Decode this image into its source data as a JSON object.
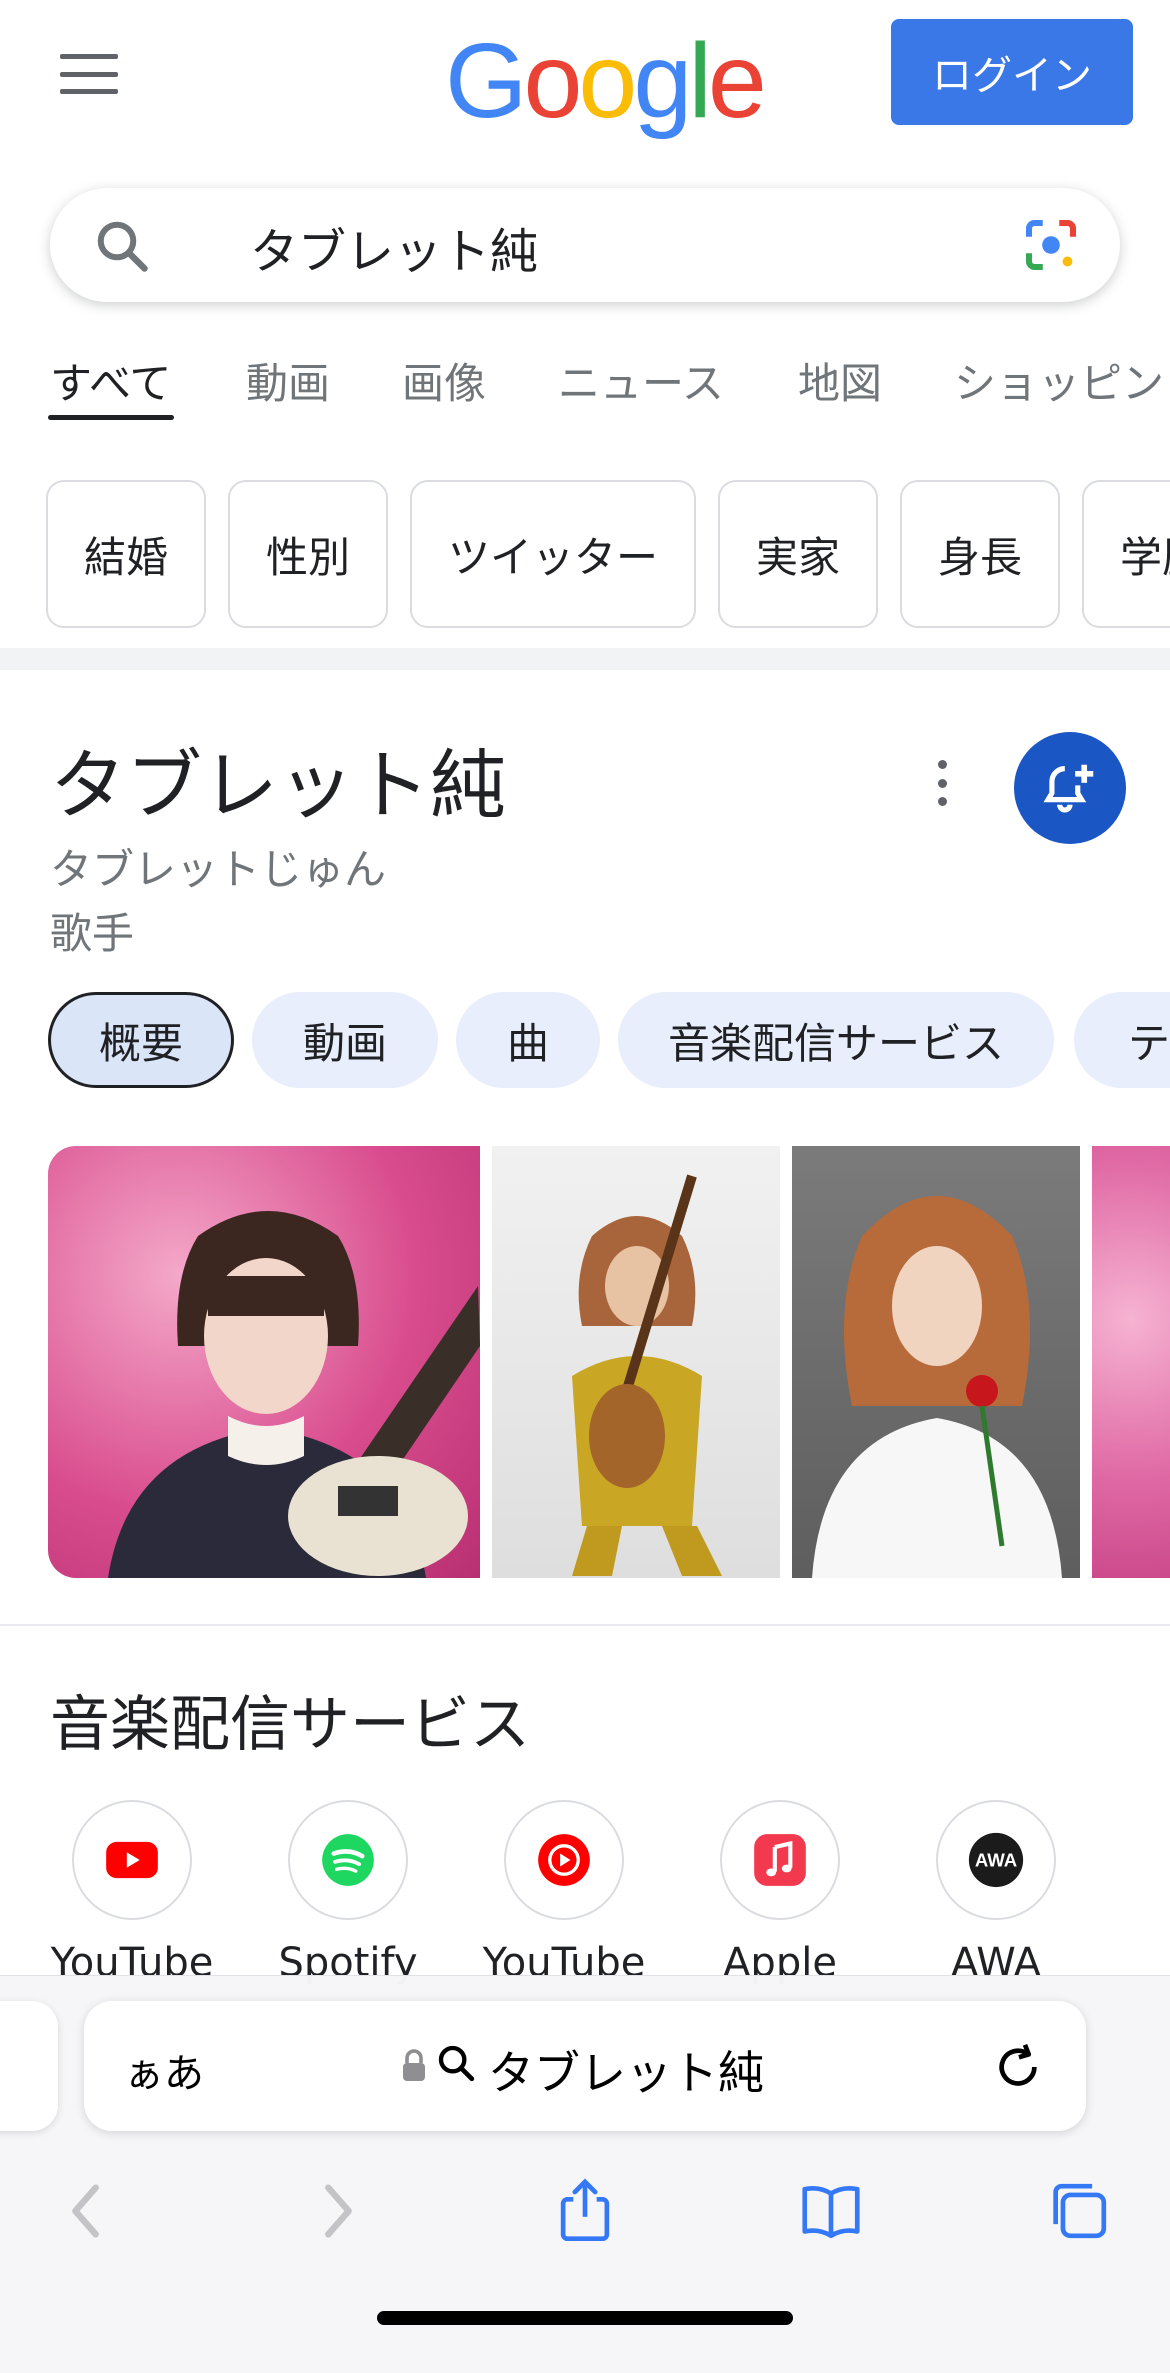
{
  "header": {
    "logo": [
      "G",
      "o",
      "o",
      "g",
      "l",
      "e"
    ],
    "login_label": "ログイン"
  },
  "search": {
    "query": "タブレット純"
  },
  "tabs": [
    "すべて",
    "動画",
    "画像",
    "ニュース",
    "地図",
    "ショッピン"
  ],
  "chips": [
    "結婚",
    "性別",
    "ツイッター",
    "実家",
    "身長",
    "学歴"
  ],
  "knowledge_panel": {
    "title": "タブレット純",
    "reading": "タブレットじゅん",
    "type": "歌手",
    "pills": [
      "概要",
      "動画",
      "曲",
      "音楽配信サービス",
      "テ"
    ]
  },
  "music_services": {
    "title": "音楽配信サービス",
    "items": [
      {
        "label": "YouTube",
        "icon": "youtube-icon"
      },
      {
        "label": "Spotify",
        "icon": "spotify-icon"
      },
      {
        "label": "YouTube",
        "icon": "youtube-music-icon"
      },
      {
        "label": "Apple",
        "icon": "apple-music-icon"
      },
      {
        "label": "AWA",
        "icon": "awa-icon"
      }
    ]
  },
  "safari": {
    "aa_label": "ぁあ",
    "url_text": "タブレット純"
  },
  "colors": {
    "google_blue": "#4285F4",
    "google_red": "#EA4335",
    "google_yellow": "#FBBC05",
    "google_green": "#34A853",
    "login_bg": "#3b78e7",
    "bell_bg": "#1a56c4"
  }
}
